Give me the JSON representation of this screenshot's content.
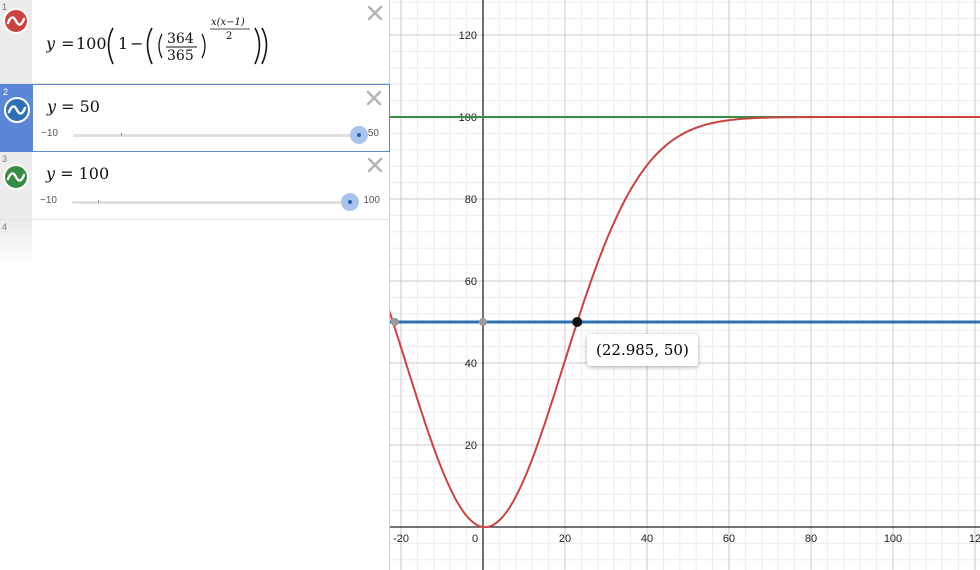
{
  "expressions": [
    {
      "index": "1",
      "color": "#c74440"
    },
    {
      "index": "2",
      "color": "#2d70b3",
      "lhs": "y",
      "eq": " = ",
      "value": "50",
      "slider": {
        "min_label": "−10",
        "max_label": "50",
        "min": -10,
        "max": 50,
        "value": 50
      }
    },
    {
      "index": "3",
      "color": "#388c46",
      "lhs": "y",
      "eq": " = ",
      "value": "100",
      "slider": {
        "min_label": "−10",
        "max_label": "100",
        "min": -10,
        "max": 100,
        "value": 100
      }
    },
    {
      "index": "4"
    }
  ],
  "formula": {
    "lhs": "y",
    "eq": " = ",
    "coef": "100",
    "one": "1",
    "minus": "−",
    "numerator": "364",
    "denominator": "365",
    "exp_numerator": "x(x−1)",
    "exp_denominator": "2"
  },
  "graph": {
    "x_tick_labels": [
      "-20",
      "0",
      "20",
      "40",
      "60",
      "80",
      "100",
      "12"
    ],
    "y_tick_labels": [
      "20",
      "40",
      "60",
      "80",
      "100",
      "120"
    ],
    "intersection": {
      "x": 22.985,
      "y": 50
    },
    "tooltip": "(22.985, 50)"
  },
  "colors": {
    "red": "#c74440",
    "blue": "#2d70b3",
    "green": "#388c46",
    "accent": "#5b87d6"
  }
}
